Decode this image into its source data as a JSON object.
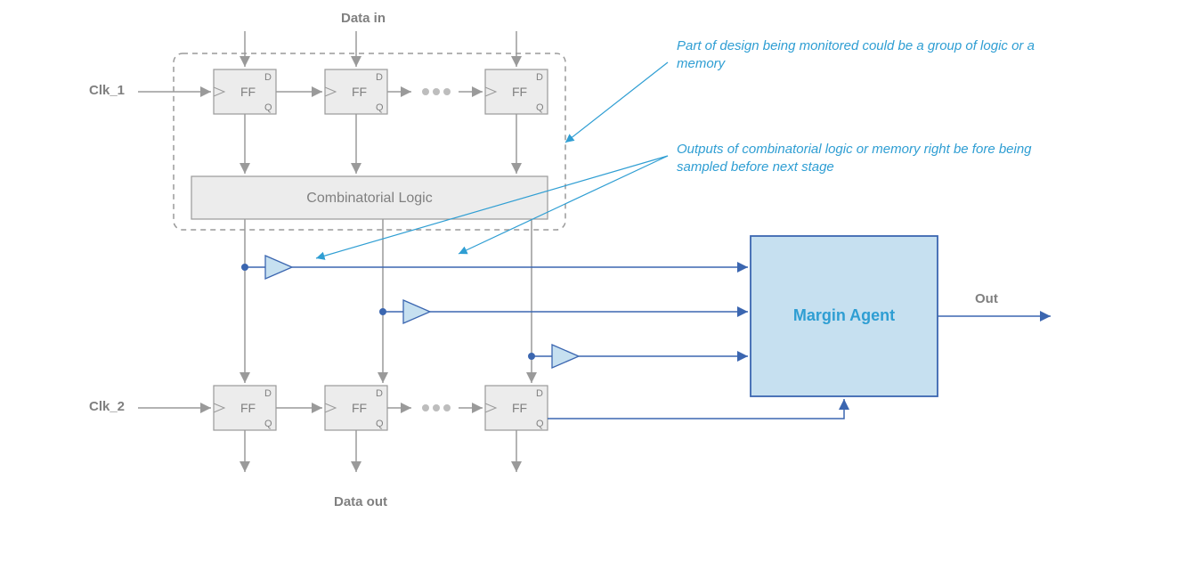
{
  "title_top": "Data in",
  "title_bottom": "Data out",
  "clk1": "Clk_1",
  "clk2": "Clk_2",
  "ff_label": "FF",
  "ff_D": "D",
  "ff_Q": "Q",
  "comb_logic": "Combinatorial Logic",
  "margin_agent": "Margin Agent",
  "out_label": "Out",
  "caption1": "Part of design being monitored could be a group of logic or a memory",
  "caption2": "Outputs of combinatorial logic or memory right be fore being sampled before next stage",
  "colors": {
    "blue_line": "#3b66b0",
    "blue_fill": "#c6e0f0",
    "blue_text": "#2f9ed3",
    "gray_line": "#9a9a9a",
    "gray_fill": "#ececec",
    "gray_text": "#808080"
  }
}
